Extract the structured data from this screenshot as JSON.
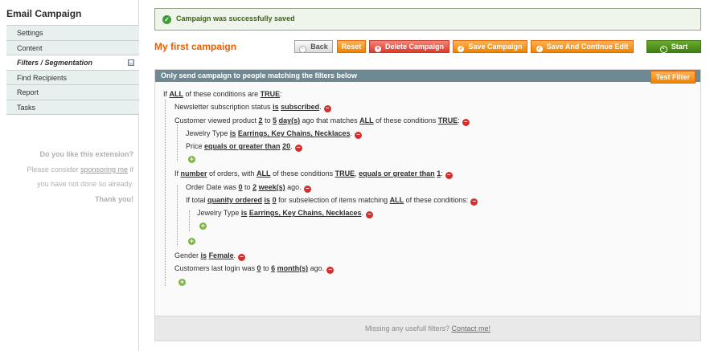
{
  "sidebar": {
    "title": "Email Campaign",
    "tabs": [
      "Settings",
      "Content",
      "Filters / Segmentation",
      "Find Recipients",
      "Report",
      "Tasks"
    ],
    "promo": {
      "line1": "Do you like this extension?",
      "line2_pre": "Please consider ",
      "line2_link": "sponsoring me",
      "line2_post": " if",
      "line3": "you have not done so already.",
      "line4": "Thank you!"
    }
  },
  "message": "Campaign was successfully saved",
  "header": {
    "title": "My first campaign",
    "buttons": {
      "back": "Back",
      "reset": "Reset",
      "delete": "Delete Campaign",
      "save": "Save Campaign",
      "save_continue": "Save And Continue Edit",
      "start": "Start"
    }
  },
  "filters": {
    "header": "Only send campaign to people matching the filters below",
    "test_button": "Test Filter",
    "footer_text": "Missing any usefull filters? ",
    "footer_link": "Contact me!",
    "root": {
      "pre": "If ",
      "agg": "ALL",
      "mid": " of these conditions are ",
      "val": "TRUE",
      "post": ":"
    },
    "c1": {
      "pre": "Newsletter subscription status ",
      "op": "is",
      "sp": " ",
      "val": "subscribed",
      "post": "."
    },
    "c2": {
      "pre": "Customer viewed product ",
      "n1": "2",
      "to": " to ",
      "n2": "5",
      "sp": " ",
      "unit": "day(s)",
      "mid": " ago that matches ",
      "agg": "ALL",
      "mid2": " of these conditions ",
      "val": "TRUE",
      "post": ":"
    },
    "c2a": {
      "pre": "Jewelry Type ",
      "op": "is",
      "sp": " ",
      "val": "Earrings, Key Chains, Necklaces",
      "post": "."
    },
    "c2b": {
      "pre": "Price ",
      "op": "equals or greater than",
      "sp": " ",
      "val": "20",
      "post": "."
    },
    "c3": {
      "pre": "If ",
      "attr": "number",
      "mid": " of orders, with ",
      "agg": "ALL",
      "mid2": " of these conditions ",
      "val": "TRUE",
      "comma": ", ",
      "op": "equals or greater than",
      "sp": " ",
      "num": "1",
      "post": ":"
    },
    "c3a": {
      "pre": "Order Date was ",
      "n1": "0",
      "to": " to ",
      "n2": "2",
      "sp": " ",
      "unit": "week(s)",
      "post": " ago."
    },
    "c3b": {
      "pre": "If total ",
      "attr": "quanity ordered",
      "sp": " ",
      "op": "is",
      "sp2": " ",
      "num": "0",
      "mid": " for subselection of items matching ",
      "agg": "ALL",
      "post": " of these conditions:"
    },
    "c3b1": {
      "pre": "Jewelry Type ",
      "op": "is",
      "sp": " ",
      "val": "Earrings, Key Chains, Necklaces",
      "post": "."
    },
    "c4": {
      "pre": "Gender ",
      "op": "is",
      "sp": " ",
      "val": "Female",
      "post": "."
    },
    "c5": {
      "pre": "Customers last login was ",
      "n1": "0",
      "to": " to ",
      "n2": "6",
      "sp": " ",
      "unit": "month(s)",
      "post": " ago."
    }
  },
  "icons": {
    "remove": "−",
    "add": "+",
    "ok": "✓"
  },
  "colors": {
    "accent": "#eb5e00",
    "header_bar": "#6f8992",
    "success_bg": "#eff5ea",
    "start_green": "#3e7f13"
  }
}
